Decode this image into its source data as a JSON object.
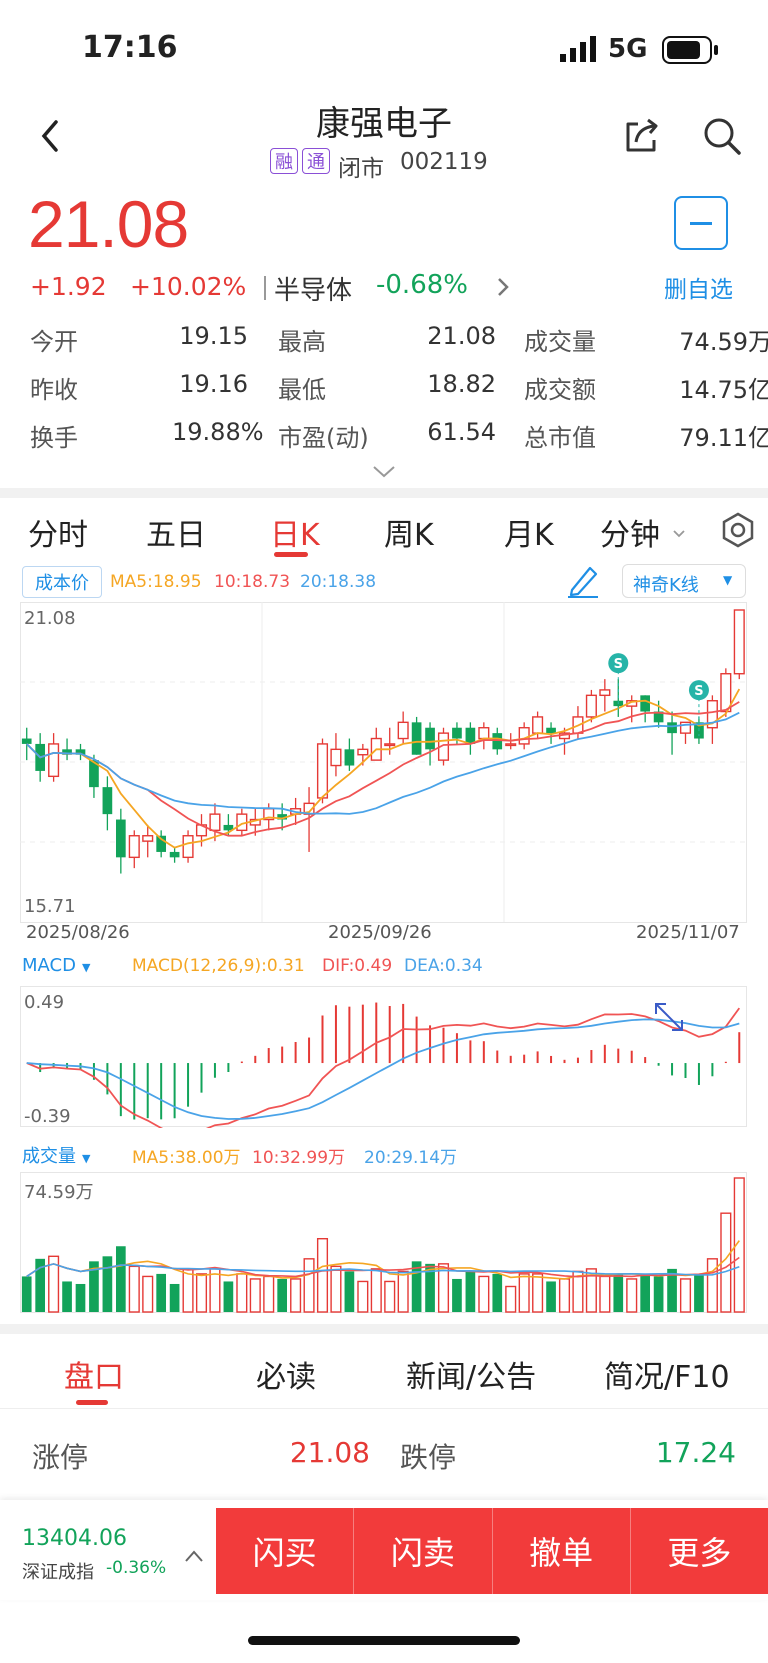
{
  "status": {
    "time": "17:16",
    "network": "5G"
  },
  "header": {
    "title": "康强电子",
    "tags": [
      "融",
      "通"
    ],
    "market_status": "闭市",
    "code": "002119"
  },
  "quote": {
    "price": "21.08",
    "change": "+1.92",
    "change_pct": "+10.02%",
    "industry": "半导体",
    "industry_change": "-0.68%",
    "remove_label": "删自选",
    "rows": [
      [
        {
          "label": "今开",
          "value": "19.15",
          "color": "green"
        },
        {
          "label": "最高",
          "value": "21.08",
          "color": "red"
        },
        {
          "label": "成交量",
          "value": "74.59万",
          "color": "plain"
        }
      ],
      [
        {
          "label": "昨收",
          "value": "19.16",
          "color": "plain"
        },
        {
          "label": "最低",
          "value": "18.82",
          "color": "green"
        },
        {
          "label": "成交额",
          "value": "14.75亿",
          "color": "plain"
        }
      ],
      [
        {
          "label": "换手",
          "value": "19.88%",
          "color": "plain"
        },
        {
          "label": "市盈(动)",
          "value": "61.54",
          "color": "plain"
        },
        {
          "label": "总市值",
          "value": "79.11亿",
          "color": "plain"
        }
      ]
    ]
  },
  "tabs": [
    "分时",
    "五日",
    "日K",
    "周K",
    "月K",
    "分钟"
  ],
  "active_tab": "日K",
  "kline": {
    "cost_label": "成本价",
    "ma_text": {
      "ma5": "MA5:18.95",
      "ma10": "10:18.73",
      "ma20": "20:18.38"
    },
    "magic_label": "神奇K线",
    "price_high": "21.08",
    "price_low": "15.71",
    "dates": [
      "2025/08/26",
      "2025/09/26",
      "2025/11/07"
    ]
  },
  "macd": {
    "label": "MACD",
    "params": "MACD(12,26,9):0.31",
    "dif": "DIF:0.49",
    "dea": "DEA:0.34",
    "top": "0.49",
    "bottom": "-0.39"
  },
  "volume": {
    "label": "成交量",
    "ma5": "MA5:38.00万",
    "ma10": "10:32.99万",
    "ma20": "20:29.14万",
    "top": "74.59万"
  },
  "card_tabs": [
    "盘口",
    "必读",
    "新闻/公告",
    "简况/F10"
  ],
  "pankou": {
    "limit_up_label": "涨停",
    "limit_up": "21.08",
    "limit_down_label": "跌停",
    "limit_down": "17.24"
  },
  "footer": {
    "index_value": "13404.06",
    "index_name": "深证成指",
    "index_change": "-0.36%",
    "buttons": [
      "闪买",
      "闪卖",
      "撤单",
      "更多"
    ]
  },
  "colors": {
    "up": "#e53935",
    "down": "#12a35a",
    "ma5": "#f5a623",
    "ma10": "#f05454",
    "ma20": "#4aa3e8",
    "buttons": "#f23b3b"
  },
  "chart_data": {
    "type": "candlestick",
    "dates_shown": [
      "2025/08/26",
      "2025/09/26",
      "2025/11/07"
    ],
    "ylim": [
      15.71,
      21.08
    ],
    "candles": [
      [
        18.7,
        18.9,
        18.3,
        18.6
      ],
      [
        18.6,
        18.8,
        17.9,
        18.1
      ],
      [
        18.0,
        18.8,
        17.9,
        18.6
      ],
      [
        18.5,
        18.7,
        18.3,
        18.4
      ],
      [
        18.5,
        18.6,
        18.3,
        18.4
      ],
      [
        18.3,
        18.4,
        17.6,
        17.8
      ],
      [
        17.8,
        18.0,
        17.0,
        17.3
      ],
      [
        17.2,
        17.4,
        16.2,
        16.5
      ],
      [
        16.5,
        17.0,
        16.3,
        16.9
      ],
      [
        16.8,
        17.1,
        16.5,
        16.9
      ],
      [
        16.9,
        17.0,
        16.5,
        16.6
      ],
      [
        16.6,
        16.7,
        16.4,
        16.5
      ],
      [
        16.5,
        17.0,
        16.4,
        16.9
      ],
      [
        16.9,
        17.3,
        16.7,
        17.1
      ],
      [
        17.0,
        17.5,
        16.8,
        17.3
      ],
      [
        17.1,
        17.3,
        16.9,
        17.0
      ],
      [
        17.0,
        17.4,
        16.9,
        17.3
      ],
      [
        17.1,
        17.4,
        16.9,
        17.2
      ],
      [
        17.2,
        17.5,
        17.0,
        17.4
      ],
      [
        17.3,
        17.5,
        17.0,
        17.2
      ],
      [
        17.3,
        17.6,
        17.1,
        17.4
      ],
      [
        17.3,
        17.8,
        16.6,
        17.5
      ],
      [
        17.6,
        18.7,
        17.5,
        18.6
      ],
      [
        18.2,
        18.8,
        18.0,
        18.5
      ],
      [
        18.5,
        18.7,
        18.1,
        18.2
      ],
      [
        18.4,
        18.6,
        18.2,
        18.5
      ],
      [
        18.3,
        18.9,
        18.3,
        18.7
      ],
      [
        18.6,
        18.9,
        18.4,
        18.6
      ],
      [
        18.7,
        19.2,
        18.6,
        19.0
      ],
      [
        19.0,
        19.1,
        18.4,
        18.4
      ],
      [
        18.9,
        19.0,
        18.2,
        18.5
      ],
      [
        18.3,
        18.9,
        18.2,
        18.8
      ],
      [
        18.9,
        19.0,
        18.6,
        18.7
      ],
      [
        18.9,
        19.0,
        18.4,
        18.6
      ],
      [
        18.7,
        19.0,
        18.5,
        18.9
      ],
      [
        18.8,
        18.9,
        18.4,
        18.5
      ],
      [
        18.6,
        18.8,
        18.5,
        18.6
      ],
      [
        18.6,
        19.0,
        18.5,
        18.9
      ],
      [
        18.8,
        19.2,
        18.7,
        19.1
      ],
      [
        18.9,
        19.0,
        18.6,
        18.8
      ],
      [
        18.7,
        18.9,
        18.4,
        18.8
      ],
      [
        18.8,
        19.3,
        18.7,
        19.1
      ],
      [
        19.1,
        19.6,
        19.0,
        19.5
      ],
      [
        19.5,
        19.8,
        19.2,
        19.6
      ],
      [
        19.4,
        19.8,
        19.1,
        19.3
      ],
      [
        19.3,
        19.5,
        19.0,
        19.4
      ],
      [
        19.5,
        19.5,
        19.0,
        19.2
      ],
      [
        19.2,
        19.4,
        18.9,
        19.0
      ],
      [
        19.0,
        19.2,
        18.4,
        18.8
      ],
      [
        18.8,
        19.0,
        18.6,
        19.0
      ],
      [
        19.0,
        19.1,
        18.6,
        18.7
      ],
      [
        18.9,
        19.5,
        18.6,
        19.4
      ],
      [
        19.2,
        20.0,
        19.1,
        19.9
      ],
      [
        19.9,
        21.08,
        19.8,
        21.08
      ]
    ]
  }
}
